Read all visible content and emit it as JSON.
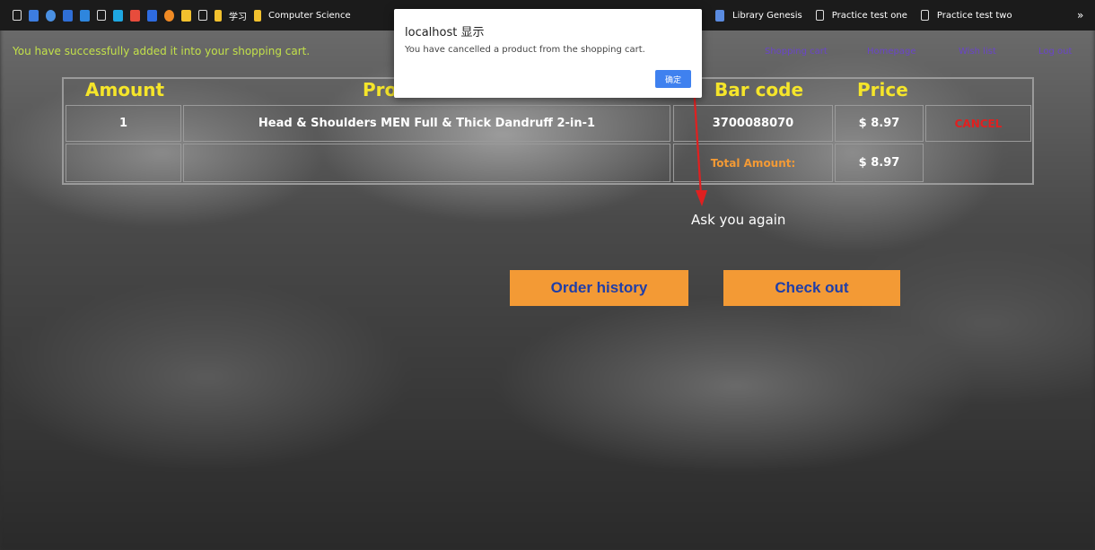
{
  "bookmarks": {
    "items": [
      "学习",
      "Computer Science",
      "Library Genesis",
      "Practice test one",
      "Practice test two"
    ],
    "overflow": "»"
  },
  "site": {
    "success_message": "You have successfully added it into your shopping cart.",
    "nav": [
      "Shopping cart",
      "Homepage",
      "Wish list",
      "Log out"
    ]
  },
  "cart": {
    "headers": {
      "amount": "Amount",
      "product": "Pro",
      "barcode": "Bar code",
      "price": "Price"
    },
    "row": {
      "amount": "1",
      "product": "Head & Shoulders MEN Full & Thick Dandruff 2-in-1",
      "barcode": "3700088070",
      "price": "$ 8.97",
      "cancel": "CANCEL"
    },
    "total_label": "Total Amount:",
    "total_value": "$ 8.97"
  },
  "ask_text": "Ask you again",
  "buttons": {
    "order_history": "Order history",
    "check_out": "Check out"
  },
  "dialog": {
    "title": "localhost 显示",
    "message": "You have cancelled a product from the shopping cart.",
    "ok": "确定"
  },
  "colors": {
    "header_yellow": "#f5e52a",
    "accent_orange": "#f39a35",
    "button_text_blue": "#1f3ea8",
    "cancel_red": "#e02020",
    "success_green": "#c2e04a",
    "dialog_blue": "#3f81ef",
    "arrow_red": "#e02020"
  },
  "icons": [
    "page-icon",
    "bookmark-folder-icon",
    "mail-icon",
    "shield-icon"
  ]
}
